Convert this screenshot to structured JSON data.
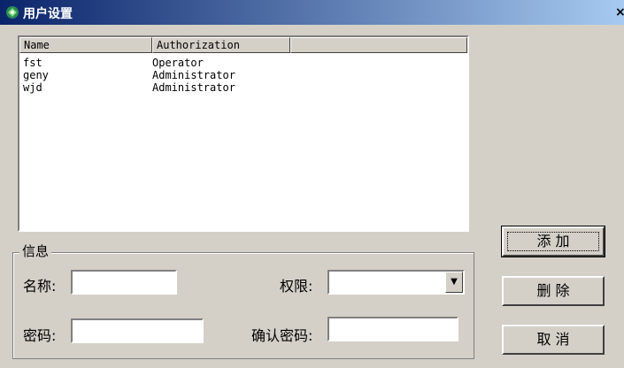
{
  "window": {
    "title": "用户设置",
    "close_glyph": "×"
  },
  "list": {
    "columns": [
      "Name",
      "Authorization",
      ""
    ],
    "rows": [
      {
        "name": "fst",
        "authorization": "Operator"
      },
      {
        "name": "geny",
        "authorization": "Administrator"
      },
      {
        "name": "wjd",
        "authorization": "Administrator"
      }
    ]
  },
  "info": {
    "group_label": "信息",
    "name_label": "名称:",
    "name_value": "",
    "permission_label": "权限:",
    "permission_value": "",
    "password_label": "密码:",
    "password_value": "",
    "confirm_label": "确认密码:",
    "confirm_value": ""
  },
  "buttons": {
    "add": "添 加",
    "delete": "删 除",
    "cancel": "取 消"
  }
}
